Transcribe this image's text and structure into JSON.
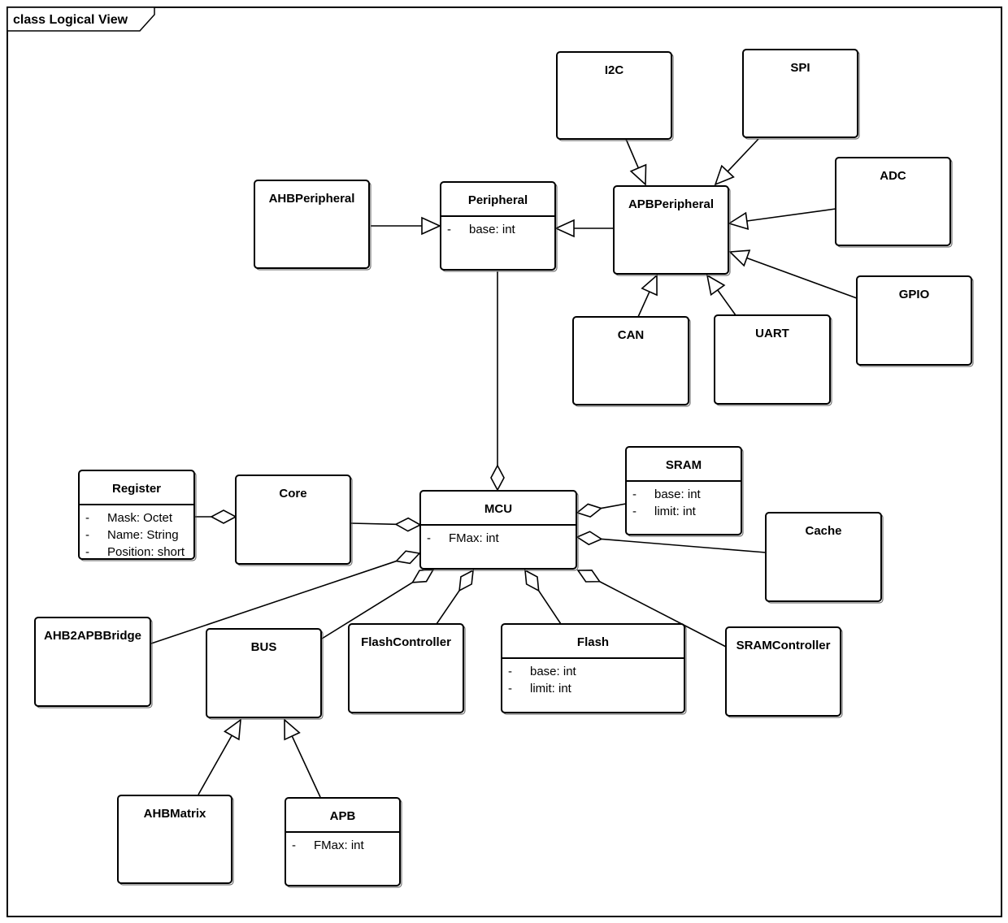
{
  "diagram": {
    "frame_title": "class Logical View",
    "classes": [
      {
        "id": "I2C",
        "name": "I2C",
        "attributes": []
      },
      {
        "id": "SPI",
        "name": "SPI",
        "attributes": []
      },
      {
        "id": "ADC",
        "name": "ADC",
        "attributes": []
      },
      {
        "id": "GPIO",
        "name": "GPIO",
        "attributes": []
      },
      {
        "id": "CAN",
        "name": "CAN",
        "attributes": []
      },
      {
        "id": "UART",
        "name": "UART",
        "attributes": []
      },
      {
        "id": "APBPeripheral",
        "name": "APBPeripheral",
        "attributes": []
      },
      {
        "id": "AHBPeripheral",
        "name": "AHBPeripheral",
        "attributes": []
      },
      {
        "id": "Peripheral",
        "name": "Peripheral",
        "attributes": [
          {
            "visibility": "-",
            "text": "base: int"
          }
        ]
      },
      {
        "id": "Register",
        "name": "Register",
        "attributes": [
          {
            "visibility": "-",
            "text": "Mask: Octet"
          },
          {
            "visibility": "-",
            "text": "Name: String"
          },
          {
            "visibility": "-",
            "text": "Position: short"
          }
        ]
      },
      {
        "id": "Core",
        "name": "Core",
        "attributes": []
      },
      {
        "id": "MCU",
        "name": "MCU",
        "attributes": [
          {
            "visibility": "-",
            "text": "FMax: int"
          }
        ]
      },
      {
        "id": "SRAM",
        "name": "SRAM",
        "attributes": [
          {
            "visibility": "-",
            "text": "base: int"
          },
          {
            "visibility": "-",
            "text": "limit: int"
          }
        ]
      },
      {
        "id": "Cache",
        "name": "Cache",
        "attributes": []
      },
      {
        "id": "AHB2APBBridge",
        "name": "AHB2APBBridge",
        "attributes": []
      },
      {
        "id": "BUS",
        "name": "BUS",
        "attributes": []
      },
      {
        "id": "FlashController",
        "name": "FlashController",
        "attributes": []
      },
      {
        "id": "Flash",
        "name": "Flash",
        "attributes": [
          {
            "visibility": "-",
            "text": "base: int"
          },
          {
            "visibility": "-",
            "text": "limit: int"
          }
        ]
      },
      {
        "id": "SRAMController",
        "name": "SRAMController",
        "attributes": []
      },
      {
        "id": "AHBMatrix",
        "name": "AHBMatrix",
        "attributes": []
      },
      {
        "id": "APB",
        "name": "APB",
        "attributes": [
          {
            "visibility": "-",
            "text": "FMax: int"
          }
        ]
      }
    ],
    "relationships": [
      {
        "type": "generalization",
        "from": "I2C",
        "to": "APBPeripheral"
      },
      {
        "type": "generalization",
        "from": "SPI",
        "to": "APBPeripheral"
      },
      {
        "type": "generalization",
        "from": "ADC",
        "to": "APBPeripheral"
      },
      {
        "type": "generalization",
        "from": "GPIO",
        "to": "APBPeripheral"
      },
      {
        "type": "generalization",
        "from": "CAN",
        "to": "APBPeripheral"
      },
      {
        "type": "generalization",
        "from": "UART",
        "to": "APBPeripheral"
      },
      {
        "type": "generalization",
        "from": "APBPeripheral",
        "to": "Peripheral"
      },
      {
        "type": "generalization",
        "from": "AHBPeripheral",
        "to": "Peripheral"
      },
      {
        "type": "generalization",
        "from": "AHBMatrix",
        "to": "BUS"
      },
      {
        "type": "generalization",
        "from": "APB",
        "to": "BUS"
      },
      {
        "type": "aggregation",
        "part": "Peripheral",
        "whole": "MCU"
      },
      {
        "type": "aggregation",
        "part": "Register",
        "whole": "Core"
      },
      {
        "type": "aggregation",
        "part": "Core",
        "whole": "MCU"
      },
      {
        "type": "aggregation",
        "part": "SRAM",
        "whole": "MCU"
      },
      {
        "type": "aggregation",
        "part": "Cache",
        "whole": "MCU"
      },
      {
        "type": "aggregation",
        "part": "AHB2APBBridge",
        "whole": "MCU"
      },
      {
        "type": "aggregation",
        "part": "BUS",
        "whole": "MCU"
      },
      {
        "type": "aggregation",
        "part": "FlashController",
        "whole": "MCU"
      },
      {
        "type": "aggregation",
        "part": "Flash",
        "whole": "MCU"
      },
      {
        "type": "aggregation",
        "part": "SRAMController",
        "whole": "MCU"
      }
    ]
  }
}
